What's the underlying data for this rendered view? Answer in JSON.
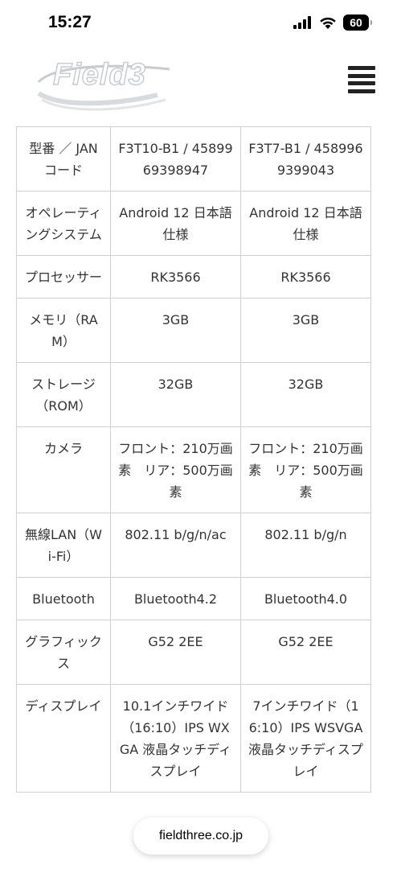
{
  "status_bar": {
    "time": "15:27",
    "battery": "60"
  },
  "header": {
    "logo_text": "Field3",
    "menu_icon": "hamburger-menu-icon"
  },
  "spec_table": {
    "rows": [
      {
        "label": "型番 ／ JANコード",
        "col1": "F3T10-B1 / 4589969398947",
        "col2": "F3T7-B1 / 4589969399043"
      },
      {
        "label": "オペレーティングシステム",
        "col1": "Android 12 日本語仕様",
        "col2": "Android 12 日本語仕様"
      },
      {
        "label": "プロセッサー",
        "col1": "RK3566",
        "col2": "RK3566"
      },
      {
        "label": "メモリ（RAM）",
        "col1": "3GB",
        "col2": "3GB"
      },
      {
        "label": "ストレージ（ROM）",
        "col1": "32GB",
        "col2": "32GB"
      },
      {
        "label": "カメラ",
        "col1": "フロント：210万画素　リア：500万画素",
        "col2": "フロント：210万画素　リア：500万画素"
      },
      {
        "label": "無線LAN（Wi-Fi）",
        "col1": "802.11 b/g/n/ac",
        "col2": "802.11 b/g/n"
      },
      {
        "label": "Bluetooth",
        "col1": "Bluetooth4.2",
        "col2": "Bluetooth4.0"
      },
      {
        "label": "グラフィックス",
        "col1": "G52 2EE",
        "col2": "G52 2EE"
      },
      {
        "label": "ディスプレイ",
        "col1": "10.1インチワイド（16:10）IPS WXGA 液晶タッチディスプレイ",
        "col2": "7インチワイド（16:10）IPS WSVGA 液晶タッチディスプレイ"
      }
    ]
  },
  "browser": {
    "url": "fieldthree.co.jp"
  }
}
